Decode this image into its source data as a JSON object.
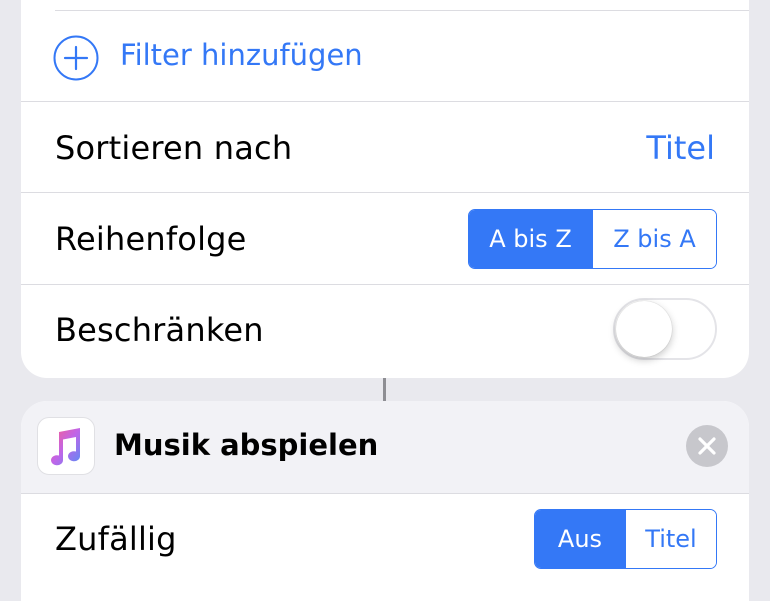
{
  "filter": {
    "add_label": "Filter hinzufügen",
    "add_icon": "plus-circle-icon"
  },
  "sort": {
    "label": "Sortieren nach",
    "value": "Titel"
  },
  "order": {
    "label": "Reihenfolge",
    "options": [
      "A bis Z",
      "Z bis A"
    ],
    "selected": "A bis Z"
  },
  "limit": {
    "label": "Beschränken",
    "enabled": false
  },
  "action": {
    "title": "Musik abspielen",
    "icon": "music-note-icon",
    "remove_icon": "close-circle-icon"
  },
  "shuffle": {
    "label": "Zufällig",
    "options": [
      "Aus",
      "Titel"
    ],
    "selected": "Aus"
  },
  "colors": {
    "accent": "#3478f6",
    "background": "#e9e9ee",
    "header": "#f2f2f6"
  }
}
